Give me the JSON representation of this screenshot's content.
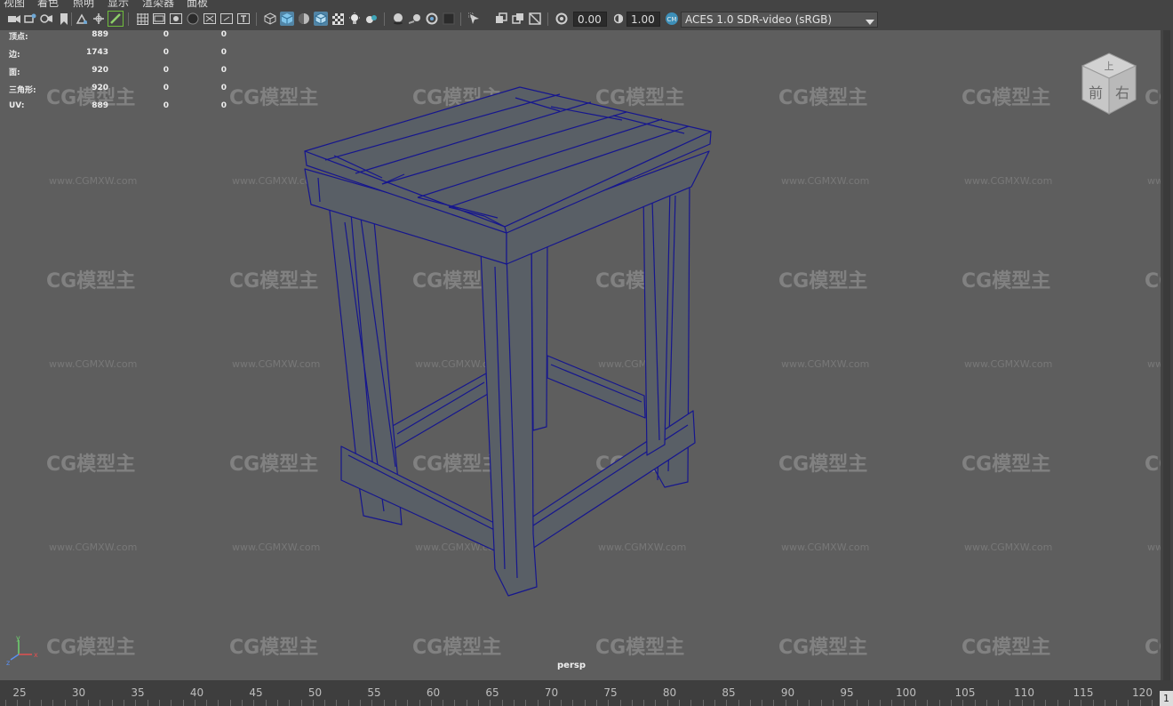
{
  "menu": [
    "视图",
    "着色",
    "照明",
    "显示",
    "渲染器",
    "面板"
  ],
  "toolbar": {
    "icons": [
      "camera-icon",
      "camera-attributes-icon",
      "bookmark-icon",
      "image-plane-icon",
      "2d-pan-zoom-icon",
      "grease-pencil-icon",
      "grid-icon",
      "film-gate-icon",
      "resolution-gate-icon",
      "gate-mask-icon",
      "field-chart-icon",
      "safe-action-icon",
      "safe-title-icon",
      "wireframe-icon",
      "smooth-shade-icon",
      "shade-wireframe-icon",
      "xray-icon",
      "textured-icon",
      "lights-icon",
      "shadows-icon",
      "ambient-occlusion-icon",
      "motion-blur-icon",
      "anti-aliasing-icon",
      "depth-of-field-icon",
      "isolate-select-icon",
      "xray-active-icon",
      "xray-joints-icon",
      "backface-icon",
      "exposure-icon",
      "gamma-icon",
      "color-management-icon"
    ],
    "exposure_value": "0.00",
    "gamma_value": "1.00",
    "color_space": "ACES 1.0 SDR-video (sRGB)"
  },
  "hud": {
    "rows": [
      {
        "label": "顶点:",
        "v1": "889",
        "v2": "0",
        "v3": "0"
      },
      {
        "label": "边:",
        "v1": "1743",
        "v2": "0",
        "v3": "0"
      },
      {
        "label": "面:",
        "v1": "920",
        "v2": "0",
        "v3": "0"
      },
      {
        "label": "三角形:",
        "v1": "920",
        "v2": "0",
        "v3": "0"
      },
      {
        "label": "UV:",
        "v1": "889",
        "v2": "0",
        "v3": "0"
      }
    ]
  },
  "watermark": {
    "logo": "CG模型主",
    "url": "www.CGMXW.com"
  },
  "viewcube": {
    "top": "上",
    "front": "前",
    "right": "右"
  },
  "camera_label": "persp",
  "axis": {
    "x": "x",
    "y": "y",
    "z": "z"
  },
  "timeline": {
    "ticks": [
      "25",
      "30",
      "35",
      "40",
      "45",
      "50",
      "55",
      "60",
      "65",
      "70",
      "75",
      "80",
      "85",
      "90",
      "95",
      "100",
      "105",
      "110",
      "115",
      "120"
    ],
    "current_frame": "1"
  },
  "colors": {
    "viewport": "#5e5e5e",
    "ui": "#444444",
    "wire": "#1c1c9a",
    "mesh": "#595f66",
    "active": "#5285a6"
  }
}
